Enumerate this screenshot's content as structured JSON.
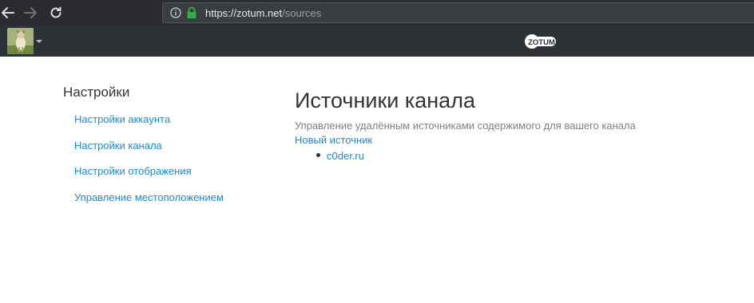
{
  "browser": {
    "url_host": "https://zotum.net",
    "url_path": "/sources",
    "icons": {
      "back": "arrow-left-icon",
      "forward": "arrow-right-icon",
      "reload": "reload-icon",
      "info": "info-icon",
      "lock": "lock-icon"
    }
  },
  "navbar": {
    "logo_text": "ZOTUM",
    "avatar": "channel-avatar",
    "menu_caret": "caret-down-icon"
  },
  "sidebar": {
    "title": "Настройки",
    "items": [
      {
        "label": "Настройки аккаунта"
      },
      {
        "label": "Настройки канала"
      },
      {
        "label": "Настройки отображения"
      },
      {
        "label": "Управление местоположением"
      }
    ]
  },
  "main": {
    "title": "Источники канала",
    "description": "Управление удалённым источниками содержимого для вашего канала",
    "new_source_label": "Новый источник",
    "sources": [
      {
        "label": "c0der.ru"
      }
    ]
  },
  "colors": {
    "link": "#1a8ad2",
    "chrome_bg": "#2a2c30",
    "navbar_bg": "#2e3135",
    "lock_green": "#2ab24a"
  }
}
